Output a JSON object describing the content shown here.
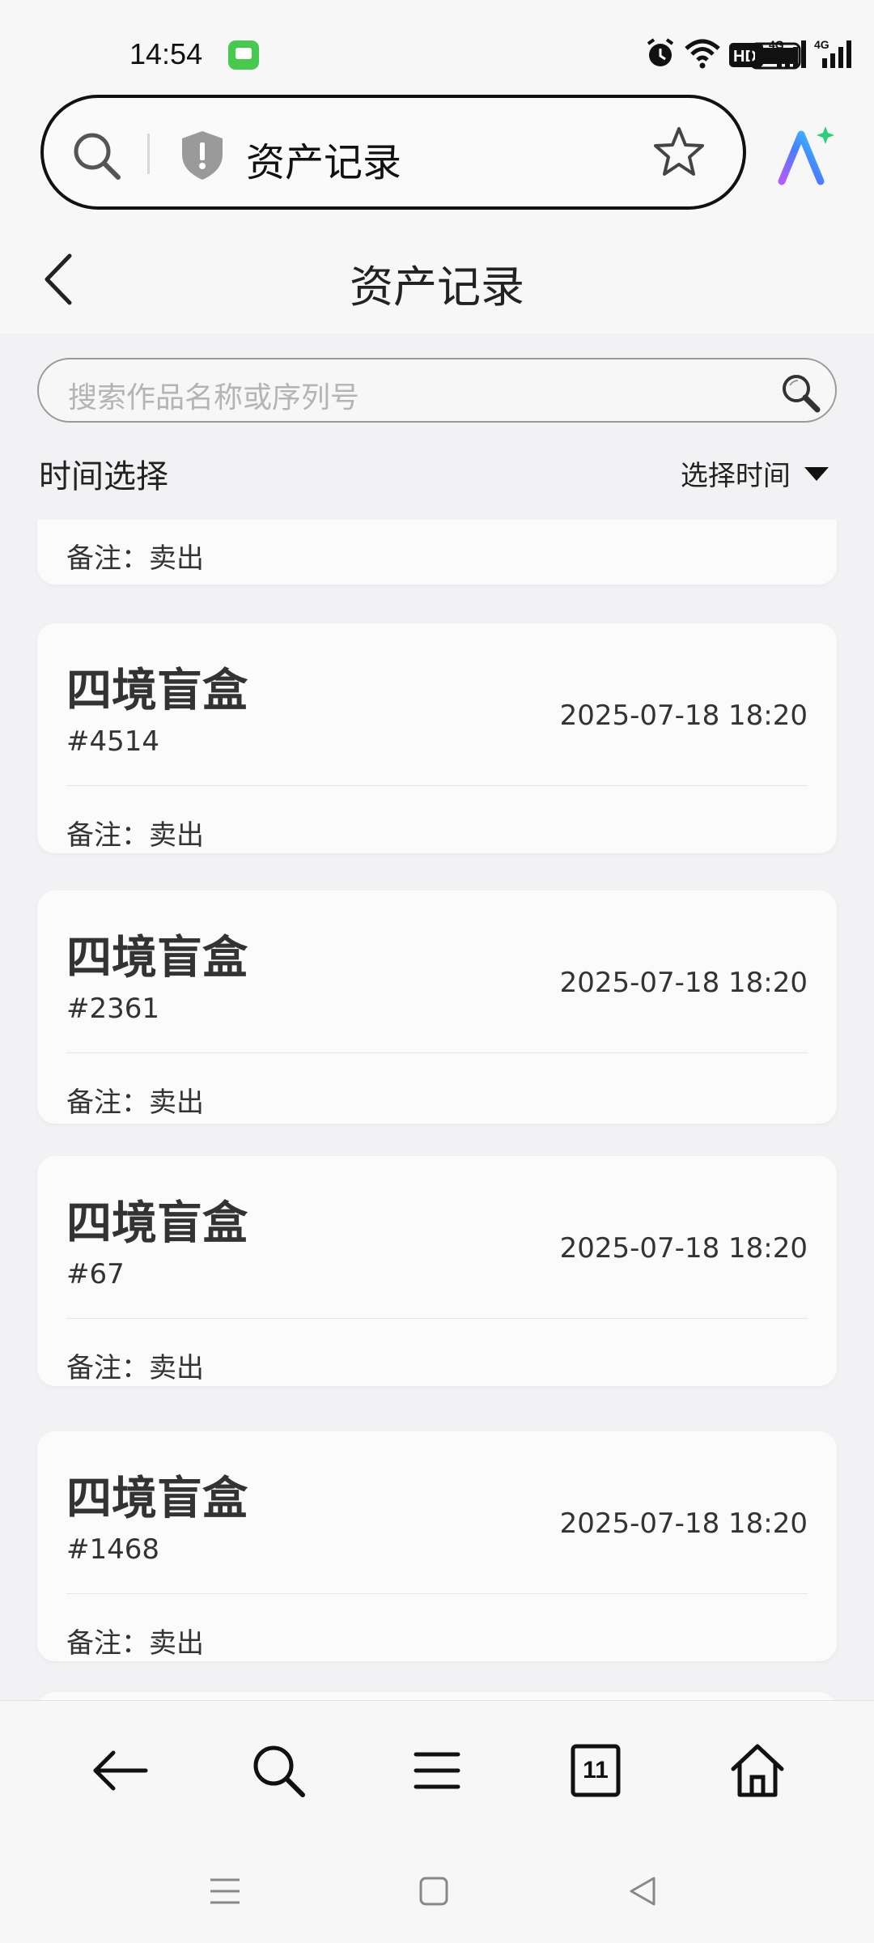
{
  "status_bar": {
    "time": "14:54",
    "icons": [
      "message-app-icon",
      "alarm-icon",
      "wifi-icon",
      "hd-icon",
      "signal-4g-icon",
      "signal-4g-icon",
      "battery-icon"
    ]
  },
  "browser": {
    "url_title": "资产记录",
    "icons": [
      "search-icon",
      "shield-warning-icon",
      "star-icon",
      "ai-assistant-icon"
    ]
  },
  "page": {
    "title": "资产记录"
  },
  "search": {
    "placeholder": "搜索作品名称或序列号"
  },
  "filter": {
    "label": "时间选择",
    "select_text": "选择时间"
  },
  "records": [
    {
      "name": "",
      "serial": "",
      "time": "",
      "note": "备注：卖出",
      "partial": true
    },
    {
      "name": "四境盲盒",
      "serial": "#4514",
      "time": "2025-07-18 18:20",
      "note": "备注：卖出"
    },
    {
      "name": "四境盲盒",
      "serial": "#2361",
      "time": "2025-07-18 18:20",
      "note": "备注：卖出"
    },
    {
      "name": "四境盲盒",
      "serial": "#67",
      "time": "2025-07-18 18:20",
      "note": "备注：卖出"
    },
    {
      "name": "四境盲盒",
      "serial": "#1468",
      "time": "2025-07-18 18:20",
      "note": "备注：卖出"
    }
  ],
  "toolbar": {
    "tabs_count": "11",
    "icons": [
      "back-arrow-icon",
      "search-icon",
      "menu-icon",
      "tabs-icon",
      "home-icon"
    ]
  },
  "colors": {
    "background": "#f2f2f4",
    "card": "#fbfbfc",
    "text": "#333333",
    "placeholder": "#b4b4b4"
  }
}
